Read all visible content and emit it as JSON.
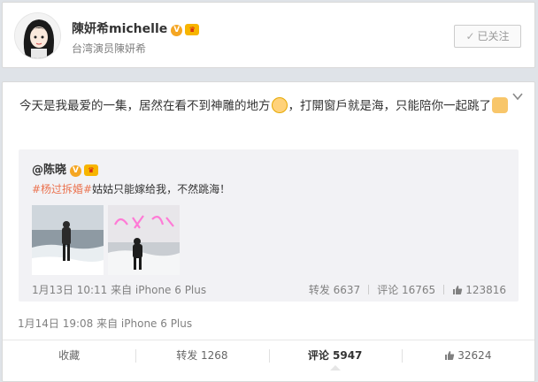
{
  "profile": {
    "name": "陳妍希michelle",
    "description": "台湾演员陳妍希",
    "follow_label": "已关注",
    "follow_check": "✓"
  },
  "post": {
    "text_1": "今天是我最爱的一集，居然在看不到神雕的地方",
    "text_2": "，打開窗戶就是海，只能陪你一起跳了",
    "time": "1月14日 19:08 来自 iPhone 6 Plus",
    "actions": {
      "favorite": "收藏",
      "repost": "转发 1268",
      "comment": "评论 5947",
      "like": "32624"
    }
  },
  "repost": {
    "user": "@陈晓",
    "tag": "#杨过拆婚#",
    "text": "姑姑只能嫁给我，不然跳海！",
    "time": "1月13日 10:11 来自 iPhone 6 Plus",
    "repost_count": "转发 6637",
    "comment_count": "评论 16765",
    "like_count": "123816"
  }
}
